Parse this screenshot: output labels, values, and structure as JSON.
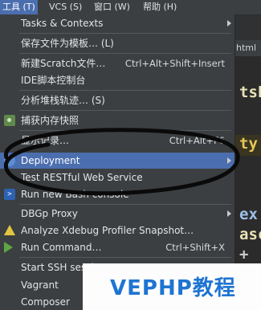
{
  "menubar": {
    "items": [
      {
        "label": "工具 (T)",
        "active": true
      },
      {
        "label": "VCS (S)"
      },
      {
        "label": "窗口 (W)"
      },
      {
        "label": "帮助 (H)"
      }
    ]
  },
  "editor_background": {
    "tab_label": "html",
    "code_fragments": [
      "tsh",
      "ty",
      "ex.",
      "asc",
      "+"
    ]
  },
  "tools_menu": {
    "items": [
      {
        "label": "Tasks & Contexts",
        "submenu": true
      },
      {
        "label": "保存文件为模板… (L)"
      },
      {
        "label": "新建Scratch文件…",
        "shortcut": "Ctrl+Alt+Shift+Insert"
      },
      {
        "label": "IDE脚本控制台"
      },
      {
        "label": "分析堆栈轨迹… (S)"
      },
      {
        "label": "捕获内存快照",
        "icon": "camera-icon"
      },
      {
        "label": "显示记录…",
        "shortcut": "Ctrl+Alt+F6"
      },
      {
        "label": "Deployment",
        "submenu": true,
        "selected": true,
        "icon": "deployment-icon"
      },
      {
        "label": "Test RESTful Web Service"
      },
      {
        "label": "Run new Bash console",
        "icon": "terminal-icon"
      },
      {
        "label": "DBGp Proxy",
        "submenu": true
      },
      {
        "label": "Analyze Xdebug Profiler Snapshot…",
        "icon": "warning-icon"
      },
      {
        "label": "Run Command…",
        "shortcut": "Ctrl+Shift+X",
        "icon": "run-icon"
      },
      {
        "label": "Start SSH session…"
      },
      {
        "label": "Vagrant"
      },
      {
        "label": "Composer"
      }
    ]
  },
  "watermark": {
    "text": "VEPHP教程"
  },
  "colors": {
    "accent": "#4b6eaf",
    "menu_bg": "#3c3f41",
    "watermark_blue": "#1e74d2"
  }
}
